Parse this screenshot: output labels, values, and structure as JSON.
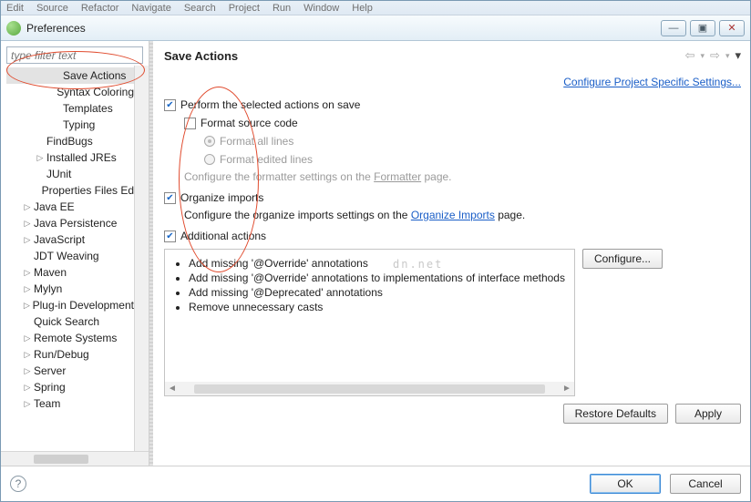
{
  "menubar": [
    "Edit",
    "Source",
    "Refactor",
    "Navigate",
    "Search",
    "Project",
    "Run",
    "Window",
    "Help"
  ],
  "window": {
    "title": "Preferences"
  },
  "winbtns": {
    "min": "—",
    "max": "▣",
    "close": "✕"
  },
  "sidebar": {
    "filter_placeholder": "type filter text",
    "items": [
      {
        "label": "Save Actions",
        "indent": 3,
        "exp": "none",
        "selected": true
      },
      {
        "label": "Syntax Coloring",
        "indent": 3,
        "exp": "none"
      },
      {
        "label": "Templates",
        "indent": 3,
        "exp": "none"
      },
      {
        "label": "Typing",
        "indent": 3,
        "exp": "none"
      },
      {
        "label": "FindBugs",
        "indent": 2,
        "exp": "none"
      },
      {
        "label": "Installed JREs",
        "indent": 2,
        "exp": "closed"
      },
      {
        "label": "JUnit",
        "indent": 2,
        "exp": "none"
      },
      {
        "label": "Properties Files Ed",
        "indent": 2,
        "exp": "none"
      },
      {
        "label": "Java EE",
        "indent": 1,
        "exp": "closed"
      },
      {
        "label": "Java Persistence",
        "indent": 1,
        "exp": "closed"
      },
      {
        "label": "JavaScript",
        "indent": 1,
        "exp": "closed"
      },
      {
        "label": "JDT Weaving",
        "indent": 1,
        "exp": "none"
      },
      {
        "label": "Maven",
        "indent": 1,
        "exp": "closed"
      },
      {
        "label": "Mylyn",
        "indent": 1,
        "exp": "closed"
      },
      {
        "label": "Plug-in Development",
        "indent": 1,
        "exp": "closed"
      },
      {
        "label": "Quick Search",
        "indent": 1,
        "exp": "none"
      },
      {
        "label": "Remote Systems",
        "indent": 1,
        "exp": "closed"
      },
      {
        "label": "Run/Debug",
        "indent": 1,
        "exp": "closed"
      },
      {
        "label": "Server",
        "indent": 1,
        "exp": "closed"
      },
      {
        "label": "Spring",
        "indent": 1,
        "exp": "closed"
      },
      {
        "label": "Team",
        "indent": 1,
        "exp": "closed"
      }
    ]
  },
  "main": {
    "title": "Save Actions",
    "config_link": "Configure Project Specific Settings...",
    "perform_label": "Perform the selected actions on save",
    "format_code_label": "Format source code",
    "format_all_label": "Format all lines",
    "format_edited_label": "Format edited lines",
    "formatter_note_pre": "Configure the formatter settings on the ",
    "formatter_link": "Formatter",
    "formatter_note_post": " page.",
    "organize_label": "Organize imports",
    "organize_note_pre": "Configure the organize imports settings on the ",
    "organize_link": "Organize Imports",
    "organize_note_post": " page.",
    "additional_label": "Additional actions",
    "additional_items": [
      "Add missing '@Override' annotations",
      "Add missing '@Override' annotations to implementations of interface methods",
      "Add missing '@Deprecated' annotations",
      "Remove unnecessary casts"
    ],
    "configure_btn": "Configure...",
    "restore_btn": "Restore Defaults",
    "apply_btn": "Apply"
  },
  "footer": {
    "ok": "OK",
    "cancel": "Cancel"
  },
  "watermark": "dn.net"
}
